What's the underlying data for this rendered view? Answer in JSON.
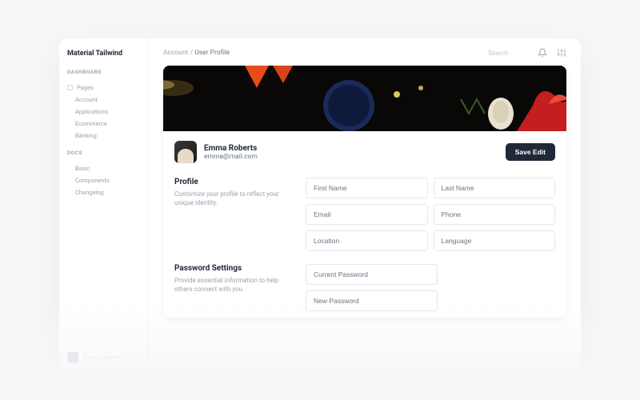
{
  "brand": "Material Tailwind",
  "sidebar": {
    "sections": [
      {
        "label": "DASHBOARD",
        "items": [
          "Pages",
          "Account",
          "Applications",
          "Ecommerce",
          "Banking"
        ]
      },
      {
        "label": "DOCS",
        "items": [
          "Basic",
          "Components",
          "Changelog"
        ]
      }
    ],
    "user": "Emma Roberts"
  },
  "breadcrumb": {
    "parent": "Account",
    "sep": "/",
    "current": "User Profile"
  },
  "search": {
    "placeholder": "Search"
  },
  "profile": {
    "name": "Emma Roberts",
    "email": "emma@mail.com",
    "save_label": "Save Edit"
  },
  "sections": [
    {
      "title": "Profile",
      "desc": "Customize your profile to reflect your unique identity.",
      "fields": [
        "First Name",
        "Last Name",
        "Email",
        "Phone",
        "Location",
        "Language"
      ]
    },
    {
      "title": "Password Settings",
      "desc": "Provide essential information to help others connect with you.",
      "fields": [
        "Current Password",
        "New Password"
      ]
    }
  ]
}
